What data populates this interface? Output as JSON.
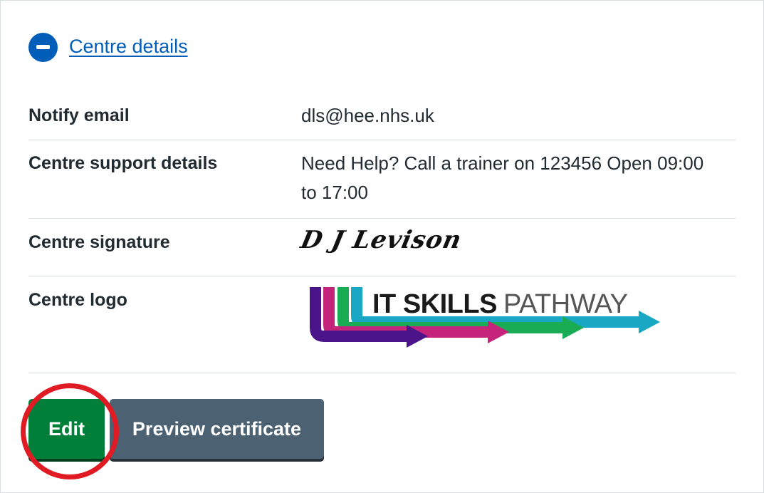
{
  "expander": {
    "title": "Centre details",
    "icon": "minus-circle-icon"
  },
  "details": {
    "rows": [
      {
        "key": "Notify email",
        "value": "dls@hee.nhs.uk"
      },
      {
        "key": "Centre support details",
        "value": "Need Help? Call a trainer on 123456 Open 09:00 to 17:00"
      },
      {
        "key": "Centre signature",
        "value": "D J Levison"
      },
      {
        "key": "Centre logo",
        "value": "IT SKILLS PATHWAY"
      }
    ]
  },
  "logo": {
    "text_bold": "IT SKILLS",
    "text_light": "PATHWAY",
    "colors": [
      "#4b1589",
      "#c4247a",
      "#1aab55",
      "#19a8c4"
    ]
  },
  "buttons": {
    "edit_label": "Edit",
    "preview_label": "Preview certificate"
  },
  "colors": {
    "link": "#005eb8",
    "edit_button": "#007f3b",
    "preview_button": "#4c6272",
    "annotation_ring": "#e01b24"
  }
}
